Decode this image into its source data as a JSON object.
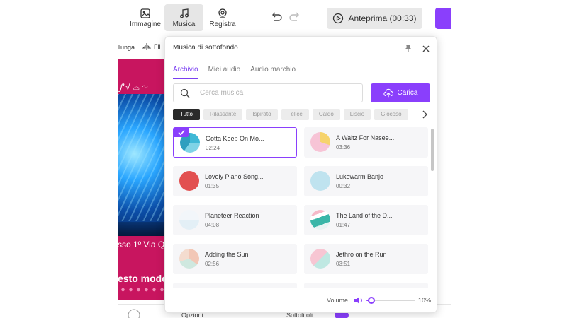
{
  "toolbar": {
    "image_label": "Immagine",
    "music_label": "Musica",
    "record_label": "Registra",
    "preview_label": "Anteprima (00:33)"
  },
  "subbar": {
    "stretch_label": "llunga",
    "flip_label": "Fli"
  },
  "canvas": {
    "caption_top": "sso 1º Via Qu",
    "caption_bottom": "esto mode"
  },
  "bottombar": {
    "options_label": "Opzioni",
    "subtitles_label": "Sottotitoli"
  },
  "popover": {
    "title": "Musica di sottofondo",
    "tabs": [
      {
        "label": "Archivio",
        "active": true
      },
      {
        "label": "Miei audio",
        "active": false
      },
      {
        "label": "Audio marchio",
        "active": false
      }
    ],
    "search_placeholder": "Cerca musica",
    "upload_label": "Carica",
    "chips": [
      "Tutto",
      "Rilassante",
      "Ispirato",
      "Felice",
      "Caldo",
      "Liscio",
      "Giocoso"
    ],
    "tracks": [
      {
        "name": "Gotta Keep On Mo...",
        "duration": "02:24",
        "selected": true,
        "thumb": "thumb-teal"
      },
      {
        "name": "A Waltz For Nasee...",
        "duration": "03:36",
        "selected": false,
        "thumb": "thumb-pink-yellow"
      },
      {
        "name": "Lovely Piano Song...",
        "duration": "01:35",
        "selected": false,
        "thumb": "thumb-red"
      },
      {
        "name": "Lukewarm Banjo",
        "duration": "00:32",
        "selected": false,
        "thumb": "thumb-lightblue"
      },
      {
        "name": "Planeteer Reaction",
        "duration": "04:08",
        "selected": false,
        "thumb": "thumb-pale"
      },
      {
        "name": "The Land of the D...",
        "duration": "01:47",
        "selected": false,
        "thumb": "thumb-teal-stripes"
      },
      {
        "name": "Adding the Sun",
        "duration": "02:56",
        "selected": false,
        "thumb": "thumb-peach-mint"
      },
      {
        "name": "Jethro on the Run",
        "duration": "03:51",
        "selected": false,
        "thumb": "thumb-pink-mint"
      }
    ],
    "volume_label": "Volume",
    "volume_value": "10%",
    "volume_fraction": 0.1
  },
  "colors": {
    "accent": "#8a3ffc",
    "canvas_pink": "#c8155f"
  }
}
